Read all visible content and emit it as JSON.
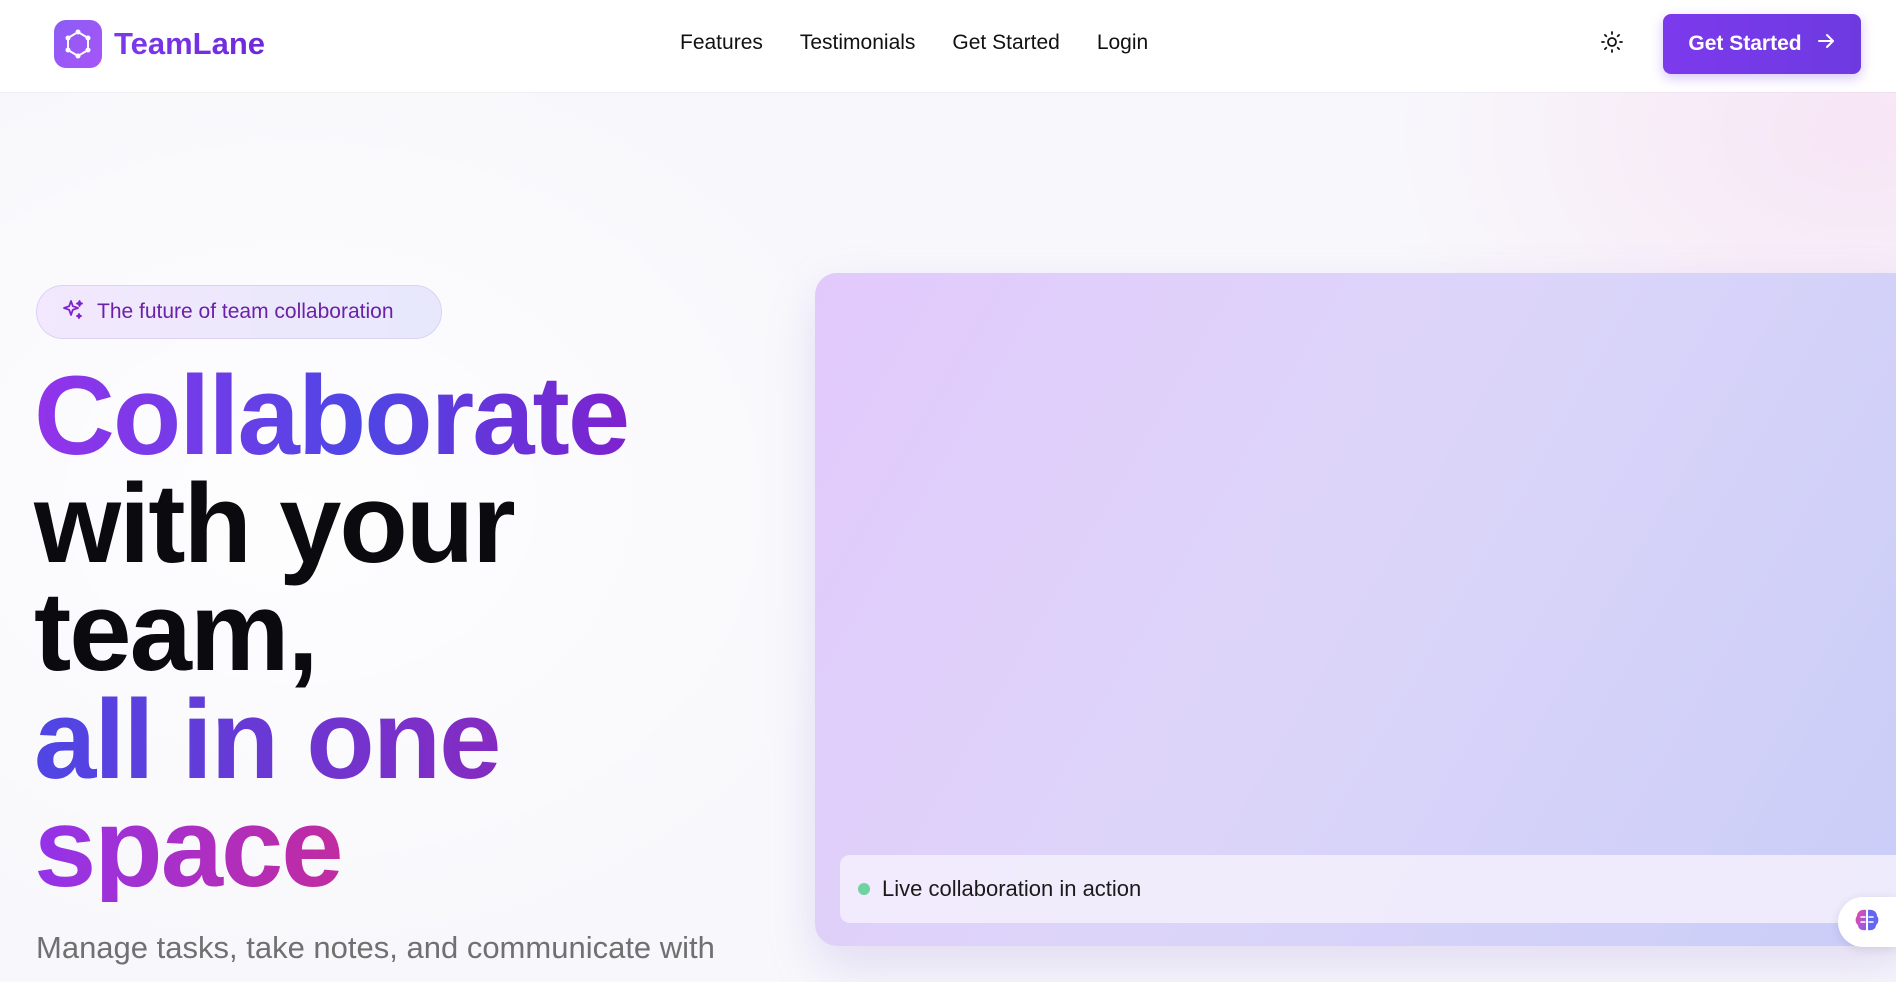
{
  "header": {
    "brand": "TeamLane",
    "nav": [
      "Features",
      "Testimonials",
      "Get Started",
      "Login"
    ],
    "cta_label": "Get Started",
    "icons": {
      "logo": "hexagon-network-icon",
      "theme": "sun-icon",
      "cta": "arrow-right-icon"
    }
  },
  "hero": {
    "badge": "The future of team collaboration",
    "headline": [
      "Collaborate",
      "with your",
      "team,",
      "all in one",
      "space"
    ],
    "subtitle": "Manage tasks, take notes, and communicate with",
    "preview_caption": "Live collaboration in action"
  },
  "colors": {
    "accent": "#7c3aed",
    "indigo": "#4f46e5",
    "pink": "#db2777",
    "live_dot": "#6ed3a0"
  }
}
